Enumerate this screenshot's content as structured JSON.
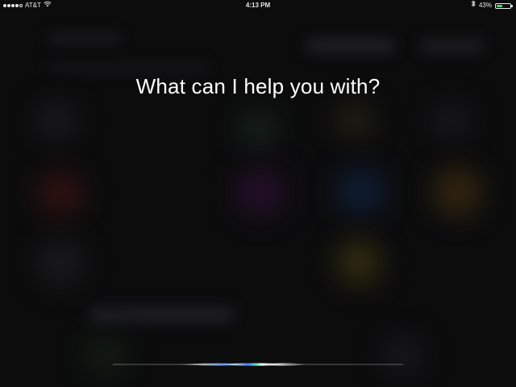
{
  "status_bar": {
    "carrier": "AT&T",
    "time": "4:13 PM",
    "battery_percent": "43%",
    "battery_level": 0.43,
    "signal_bars_filled": 4,
    "signal_bars_total": 5,
    "icons": [
      "wifi-icon",
      "bluetooth-icon",
      "battery-icon"
    ]
  },
  "siri": {
    "prompt": "What can I help you with?"
  },
  "colors": {
    "background": "#0c0c0d",
    "text": "#ffffff",
    "battery_fill": "#4cd964",
    "wave_blue": "#3d7bff",
    "wave_green": "#5df0b0",
    "wave_white": "#ffffff"
  }
}
